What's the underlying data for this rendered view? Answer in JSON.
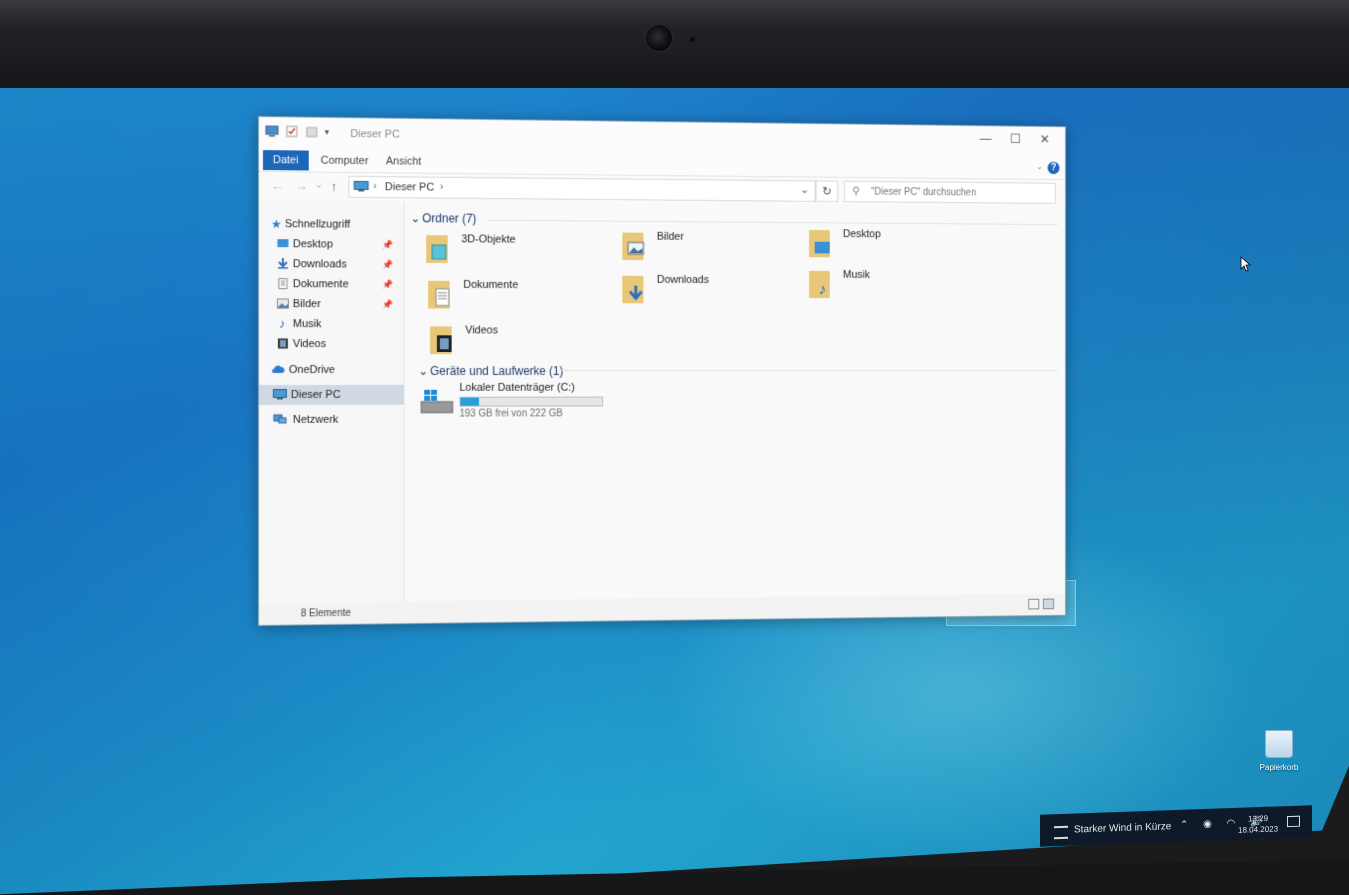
{
  "window": {
    "title": "Dieser PC",
    "controls": {
      "minimize": "—",
      "maximize": "☐",
      "close": "✕"
    }
  },
  "ribbon": {
    "tabs": [
      "Datei",
      "Computer",
      "Ansicht"
    ],
    "help": "?"
  },
  "navigation": {
    "back": "←",
    "forward": "→",
    "recent": "⌄",
    "up": "↑",
    "address": "Dieser PC",
    "address_sep": "›",
    "dropdown": "⌄",
    "refresh": "↻",
    "search_placeholder": "\"Dieser PC\" durchsuchen"
  },
  "sidebar": {
    "items": [
      {
        "label": "Schnellzugriff",
        "icon": "star-icon",
        "pinned": false
      },
      {
        "label": "Desktop",
        "icon": "desktop-icon",
        "pinned": true
      },
      {
        "label": "Downloads",
        "icon": "download-icon",
        "pinned": true
      },
      {
        "label": "Dokumente",
        "icon": "document-icon",
        "pinned": true
      },
      {
        "label": "Bilder",
        "icon": "pictures-icon",
        "pinned": true
      },
      {
        "label": "Musik",
        "icon": "music-icon",
        "pinned": false
      },
      {
        "label": "Videos",
        "icon": "video-icon",
        "pinned": false
      },
      {
        "label": "OneDrive",
        "icon": "cloud-icon",
        "pinned": false
      },
      {
        "label": "Dieser PC",
        "icon": "computer-icon",
        "pinned": false,
        "selected": true
      },
      {
        "label": "Netzwerk",
        "icon": "network-icon",
        "pinned": false
      }
    ],
    "pin_glyph": "📌"
  },
  "content": {
    "folders_group": "Ordner (7)",
    "folders": [
      {
        "label": "3D-Objekte",
        "icon": "3d-objects-folder-icon"
      },
      {
        "label": "Bilder",
        "icon": "pictures-folder-icon"
      },
      {
        "label": "Desktop",
        "icon": "desktop-folder-icon"
      },
      {
        "label": "Dokumente",
        "icon": "documents-folder-icon"
      },
      {
        "label": "Downloads",
        "icon": "downloads-folder-icon"
      },
      {
        "label": "Musik",
        "icon": "music-folder-icon"
      },
      {
        "label": "Videos",
        "icon": "videos-folder-icon"
      }
    ],
    "drives_group": "Geräte und Laufwerke (1)",
    "drive": {
      "name": "Lokaler Datenträger (C:)",
      "free_text": "193 GB frei von 222 GB",
      "used_fraction": 0.13
    }
  },
  "status": {
    "item_count": "8 Elemente"
  },
  "desktop": {
    "recycle_bin": "Papierkorb"
  },
  "taskbar": {
    "weather": "Starker Wind in Kürze",
    "tray_icons": "⌃ ◉ ◠ 🔊",
    "time": "13:29",
    "date": "18.04.2023"
  },
  "colors": {
    "accent": "#1e66b8",
    "selection": "#cfd9e3",
    "drive_bar": "#26a0da",
    "desktop_blue": "#1b77c6"
  }
}
